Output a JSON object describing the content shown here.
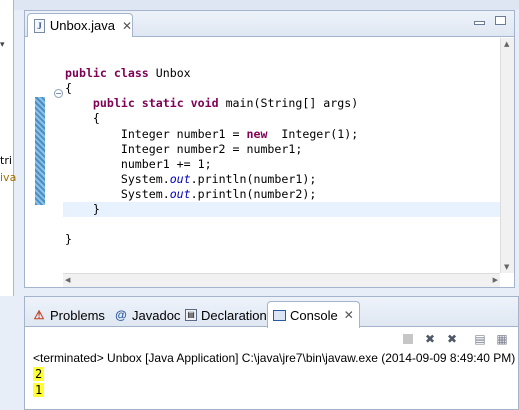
{
  "left_panel": {
    "clipped_labels": [
      "tri",
      "iva"
    ]
  },
  "editor": {
    "tab_label": "Unbox.java",
    "tab_icon": "java-file-icon",
    "code_lines": [
      [
        {
          "t": "public",
          "c": "kw"
        },
        {
          "t": " "
        },
        {
          "t": "class",
          "c": "kw"
        },
        {
          "t": " Unbox"
        }
      ],
      [
        {
          "t": "{"
        }
      ],
      [
        {
          "t": "    "
        },
        {
          "t": "public",
          "c": "kw"
        },
        {
          "t": " "
        },
        {
          "t": "static",
          "c": "kw"
        },
        {
          "t": " "
        },
        {
          "t": "void",
          "c": "kw"
        },
        {
          "t": " main(String[] args)"
        }
      ],
      [
        {
          "t": "    {"
        }
      ],
      [
        {
          "t": "        Integer number1 = "
        },
        {
          "t": "new",
          "c": "kw"
        },
        {
          "t": "  Integer(1);"
        }
      ],
      [
        {
          "t": "        Integer number2 = number1;"
        }
      ],
      [
        {
          "t": "        number1 += 1;"
        }
      ],
      [
        {
          "t": "        System."
        },
        {
          "t": "out",
          "c": "fld"
        },
        {
          "t": ".println(number1);"
        }
      ],
      [
        {
          "t": "        System."
        },
        {
          "t": "out",
          "c": "fld"
        },
        {
          "t": ".println(number2);"
        }
      ],
      [
        {
          "t": "    }"
        }
      ],
      [
        {
          "t": ""
        }
      ],
      [
        {
          "t": "}"
        }
      ]
    ]
  },
  "views": {
    "tabs": [
      {
        "label": "Problems",
        "icon": "problems-icon"
      },
      {
        "label": "Javadoc",
        "icon": "at-sign-icon"
      },
      {
        "label": "Declaration",
        "icon": "declaration-icon"
      },
      {
        "label": "Console",
        "icon": "console-icon",
        "active": true
      }
    ],
    "console": {
      "status": "<terminated> Unbox [Java Application] C:\\java\\jre7\\bin\\javaw.exe (2014-09-09 8:49:40 PM)",
      "output": [
        "2",
        "1"
      ],
      "highlight_color": "#ffff33"
    }
  },
  "colors": {
    "keyword": "#7f0055",
    "static_field": "#0000c0",
    "current_line": "#e8f2fe"
  }
}
